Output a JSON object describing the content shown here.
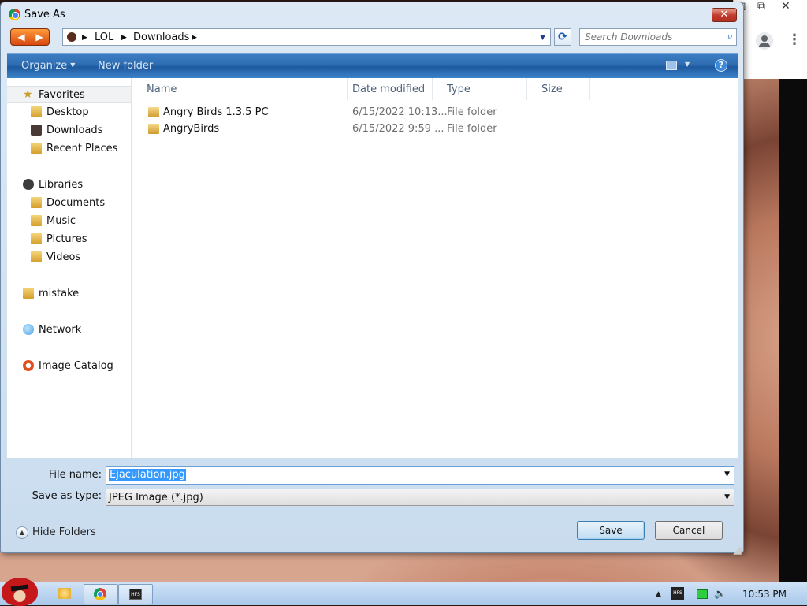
{
  "dialog": {
    "title": "Save As",
    "close_glyph": "✕",
    "icon": "chrome-icon"
  },
  "address": {
    "crumbs": [
      "LOL",
      "Downloads"
    ],
    "search_placeholder": "Search Downloads"
  },
  "toolbar": {
    "organize": "Organize",
    "new_folder": "New folder",
    "help": "?"
  },
  "nav": {
    "favorites": "Favorites",
    "desktop": "Desktop",
    "downloads": "Downloads",
    "recent_places": "Recent Places",
    "libraries": "Libraries",
    "documents": "Documents",
    "music": "Music",
    "pictures": "Pictures",
    "videos": "Videos",
    "mistake": "mistake",
    "network": "Network",
    "image_catalog": "Image Catalog"
  },
  "columns": {
    "name": "Name",
    "date_modified": "Date modified",
    "type": "Type",
    "size": "Size"
  },
  "files": [
    {
      "name": "Angry Birds 1.3.5 PC",
      "date": "6/15/2022 10:13...",
      "type": "File folder"
    },
    {
      "name": "AngryBirds",
      "date": "6/15/2022 9:59 ...",
      "type": "File folder"
    }
  ],
  "form": {
    "file_name_label": "File name:",
    "file_name_value": "Ejaculation.jpg",
    "save_type_label": "Save as type:",
    "save_type_value": "JPEG Image (*.jpg)",
    "hide_folders": "Hide Folders",
    "save": "Save",
    "cancel": "Cancel"
  },
  "taskbar": {
    "clock": "10:53 PM",
    "tray_up": "▲",
    "hfs": "HFS"
  },
  "colors": {
    "toolbar_blue": "#2f6db2",
    "selection_blue": "#3399ff",
    "close_red": "#c0392b"
  }
}
